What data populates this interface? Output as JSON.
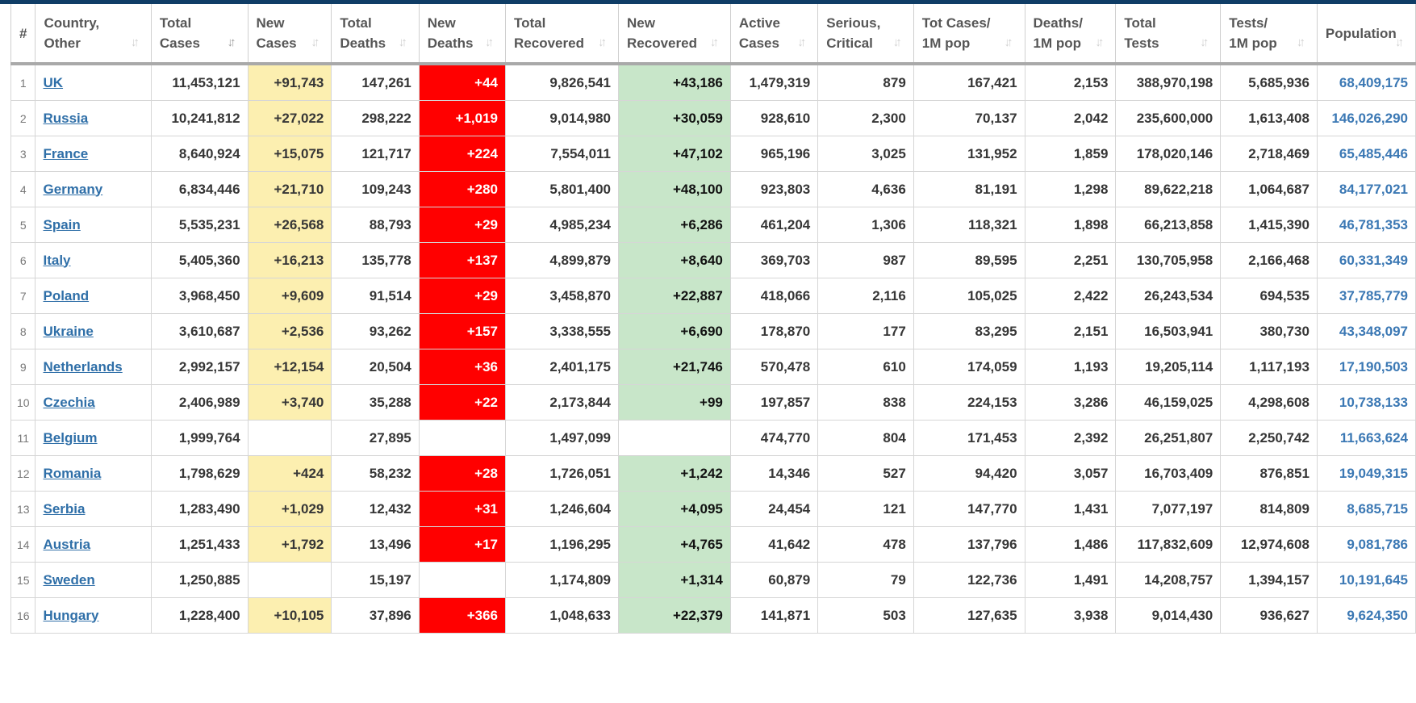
{
  "table": {
    "headers": [
      {
        "l1": "#",
        "l2": ""
      },
      {
        "l1": "Country,",
        "l2": "Other"
      },
      {
        "l1": "Total",
        "l2": "Cases"
      },
      {
        "l1": "New",
        "l2": "Cases"
      },
      {
        "l1": "Total",
        "l2": "Deaths"
      },
      {
        "l1": "New",
        "l2": "Deaths"
      },
      {
        "l1": "Total",
        "l2": "Recovered"
      },
      {
        "l1": "New",
        "l2": "Recovered"
      },
      {
        "l1": "Active",
        "l2": "Cases"
      },
      {
        "l1": "Serious,",
        "l2": "Critical"
      },
      {
        "l1": "Tot Cases/",
        "l2": "1M pop"
      },
      {
        "l1": "Deaths/",
        "l2": "1M pop"
      },
      {
        "l1": "Total",
        "l2": "Tests"
      },
      {
        "l1": "Tests/",
        "l2": "1M pop"
      },
      {
        "l1": "Population",
        "l2": ""
      }
    ],
    "rows": [
      {
        "rank": "1",
        "country": "UK",
        "total_cases": "11,453,121",
        "new_cases": "+91,743",
        "total_deaths": "147,261",
        "new_deaths": "+44",
        "total_recovered": "9,826,541",
        "new_recovered": "+43,186",
        "active_cases": "1,479,319",
        "serious": "879",
        "cases_1m": "167,421",
        "deaths_1m": "2,153",
        "total_tests": "388,970,198",
        "tests_1m": "5,685,936",
        "population": "68,409,175"
      },
      {
        "rank": "2",
        "country": "Russia",
        "total_cases": "10,241,812",
        "new_cases": "+27,022",
        "total_deaths": "298,222",
        "new_deaths": "+1,019",
        "total_recovered": "9,014,980",
        "new_recovered": "+30,059",
        "active_cases": "928,610",
        "serious": "2,300",
        "cases_1m": "70,137",
        "deaths_1m": "2,042",
        "total_tests": "235,600,000",
        "tests_1m": "1,613,408",
        "population": "146,026,290"
      },
      {
        "rank": "3",
        "country": "France",
        "total_cases": "8,640,924",
        "new_cases": "+15,075",
        "total_deaths": "121,717",
        "new_deaths": "+224",
        "total_recovered": "7,554,011",
        "new_recovered": "+47,102",
        "active_cases": "965,196",
        "serious": "3,025",
        "cases_1m": "131,952",
        "deaths_1m": "1,859",
        "total_tests": "178,020,146",
        "tests_1m": "2,718,469",
        "population": "65,485,446"
      },
      {
        "rank": "4",
        "country": "Germany",
        "total_cases": "6,834,446",
        "new_cases": "+21,710",
        "total_deaths": "109,243",
        "new_deaths": "+280",
        "total_recovered": "5,801,400",
        "new_recovered": "+48,100",
        "active_cases": "923,803",
        "serious": "4,636",
        "cases_1m": "81,191",
        "deaths_1m": "1,298",
        "total_tests": "89,622,218",
        "tests_1m": "1,064,687",
        "population": "84,177,021"
      },
      {
        "rank": "5",
        "country": "Spain",
        "total_cases": "5,535,231",
        "new_cases": "+26,568",
        "total_deaths": "88,793",
        "new_deaths": "+29",
        "total_recovered": "4,985,234",
        "new_recovered": "+6,286",
        "active_cases": "461,204",
        "serious": "1,306",
        "cases_1m": "118,321",
        "deaths_1m": "1,898",
        "total_tests": "66,213,858",
        "tests_1m": "1,415,390",
        "population": "46,781,353"
      },
      {
        "rank": "6",
        "country": "Italy",
        "total_cases": "5,405,360",
        "new_cases": "+16,213",
        "total_deaths": "135,778",
        "new_deaths": "+137",
        "total_recovered": "4,899,879",
        "new_recovered": "+8,640",
        "active_cases": "369,703",
        "serious": "987",
        "cases_1m": "89,595",
        "deaths_1m": "2,251",
        "total_tests": "130,705,958",
        "tests_1m": "2,166,468",
        "population": "60,331,349"
      },
      {
        "rank": "7",
        "country": "Poland",
        "total_cases": "3,968,450",
        "new_cases": "+9,609",
        "total_deaths": "91,514",
        "new_deaths": "+29",
        "total_recovered": "3,458,870",
        "new_recovered": "+22,887",
        "active_cases": "418,066",
        "serious": "2,116",
        "cases_1m": "105,025",
        "deaths_1m": "2,422",
        "total_tests": "26,243,534",
        "tests_1m": "694,535",
        "population": "37,785,779"
      },
      {
        "rank": "8",
        "country": "Ukraine",
        "total_cases": "3,610,687",
        "new_cases": "+2,536",
        "total_deaths": "93,262",
        "new_deaths": "+157",
        "total_recovered": "3,338,555",
        "new_recovered": "+6,690",
        "active_cases": "178,870",
        "serious": "177",
        "cases_1m": "83,295",
        "deaths_1m": "2,151",
        "total_tests": "16,503,941",
        "tests_1m": "380,730",
        "population": "43,348,097"
      },
      {
        "rank": "9",
        "country": "Netherlands",
        "total_cases": "2,992,157",
        "new_cases": "+12,154",
        "total_deaths": "20,504",
        "new_deaths": "+36",
        "total_recovered": "2,401,175",
        "new_recovered": "+21,746",
        "active_cases": "570,478",
        "serious": "610",
        "cases_1m": "174,059",
        "deaths_1m": "1,193",
        "total_tests": "19,205,114",
        "tests_1m": "1,117,193",
        "population": "17,190,503"
      },
      {
        "rank": "10",
        "country": "Czechia",
        "total_cases": "2,406,989",
        "new_cases": "+3,740",
        "total_deaths": "35,288",
        "new_deaths": "+22",
        "total_recovered": "2,173,844",
        "new_recovered": "+99",
        "active_cases": "197,857",
        "serious": "838",
        "cases_1m": "224,153",
        "deaths_1m": "3,286",
        "total_tests": "46,159,025",
        "tests_1m": "4,298,608",
        "population": "10,738,133"
      },
      {
        "rank": "11",
        "country": "Belgium",
        "total_cases": "1,999,764",
        "new_cases": "",
        "total_deaths": "27,895",
        "new_deaths": "",
        "total_recovered": "1,497,099",
        "new_recovered": "",
        "active_cases": "474,770",
        "serious": "804",
        "cases_1m": "171,453",
        "deaths_1m": "2,392",
        "total_tests": "26,251,807",
        "tests_1m": "2,250,742",
        "population": "11,663,624"
      },
      {
        "rank": "12",
        "country": "Romania",
        "total_cases": "1,798,629",
        "new_cases": "+424",
        "total_deaths": "58,232",
        "new_deaths": "+28",
        "total_recovered": "1,726,051",
        "new_recovered": "+1,242",
        "active_cases": "14,346",
        "serious": "527",
        "cases_1m": "94,420",
        "deaths_1m": "3,057",
        "total_tests": "16,703,409",
        "tests_1m": "876,851",
        "population": "19,049,315"
      },
      {
        "rank": "13",
        "country": "Serbia",
        "total_cases": "1,283,490",
        "new_cases": "+1,029",
        "total_deaths": "12,432",
        "new_deaths": "+31",
        "total_recovered": "1,246,604",
        "new_recovered": "+4,095",
        "active_cases": "24,454",
        "serious": "121",
        "cases_1m": "147,770",
        "deaths_1m": "1,431",
        "total_tests": "7,077,197",
        "tests_1m": "814,809",
        "population": "8,685,715"
      },
      {
        "rank": "14",
        "country": "Austria",
        "total_cases": "1,251,433",
        "new_cases": "+1,792",
        "total_deaths": "13,496",
        "new_deaths": "+17",
        "total_recovered": "1,196,295",
        "new_recovered": "+4,765",
        "active_cases": "41,642",
        "serious": "478",
        "cases_1m": "137,796",
        "deaths_1m": "1,486",
        "total_tests": "117,832,609",
        "tests_1m": "12,974,608",
        "population": "9,081,786"
      },
      {
        "rank": "15",
        "country": "Sweden",
        "total_cases": "1,250,885",
        "new_cases": "",
        "total_deaths": "15,197",
        "new_deaths": "",
        "total_recovered": "1,174,809",
        "new_recovered": "+1,314",
        "active_cases": "60,879",
        "serious": "79",
        "cases_1m": "122,736",
        "deaths_1m": "1,491",
        "total_tests": "14,208,757",
        "tests_1m": "1,394,157",
        "population": "10,191,645"
      },
      {
        "rank": "16",
        "country": "Hungary",
        "total_cases": "1,228,400",
        "new_cases": "+10,105",
        "total_deaths": "37,896",
        "new_deaths": "+366",
        "total_recovered": "1,048,633",
        "new_recovered": "+22,379",
        "active_cases": "141,871",
        "serious": "503",
        "cases_1m": "127,635",
        "deaths_1m": "3,938",
        "total_tests": "9,014,430",
        "tests_1m": "936,627",
        "population": "9,624,350"
      }
    ]
  },
  "icons": {
    "sort": "sort-arrows-icon",
    "sort_active": "sort-desc-active-icon"
  },
  "colors": {
    "new_cases_bg": "#fcefb0",
    "new_deaths_bg": "#ff0000",
    "new_recovered_bg": "#c8e6c9",
    "link": "#2f6fa8",
    "population_text": "#3b78b4",
    "top_band": "#0f3d66"
  }
}
